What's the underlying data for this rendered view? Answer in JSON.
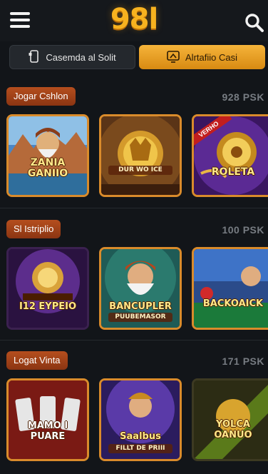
{
  "header": {
    "logo_text": "98l",
    "menu_icon": "hamburger-icon",
    "search_icon": "search-icon"
  },
  "tabs": [
    {
      "label": "Casemda al Solit",
      "icon": "phone-icon",
      "active": false
    },
    {
      "label": "Alrtafiio Casi",
      "icon": "casino-icon",
      "active": true
    }
  ],
  "sections": [
    {
      "title": "Jogar Cshlon",
      "count": "928 PSK",
      "games": [
        {
          "title": "ZANIA GANIIO",
          "subtitle": ""
        },
        {
          "title": "",
          "subtitle": "DUR WO ICE"
        },
        {
          "title": "ROLETA",
          "subtitle": "",
          "badge": "VERHO"
        }
      ]
    },
    {
      "title": "Sl Istriplio",
      "count": "100 PSK",
      "games": [
        {
          "title": "I12 EYPEIO",
          "subtitle": ""
        },
        {
          "title": "BANCUPLER",
          "subtitle": "PUUBEMASOR"
        },
        {
          "title": "BACKOAICK",
          "subtitle": ""
        }
      ]
    },
    {
      "title": "Logat Vinta",
      "count": "171 PSK",
      "games": [
        {
          "title": "MAMO I PUARE",
          "subtitle": ""
        },
        {
          "title": "Saalbus",
          "subtitle": "FILLT DE PRIII"
        },
        {
          "title": "YOLCA OANUO",
          "subtitle": ""
        }
      ]
    }
  ],
  "colors": {
    "accent": "#f5a623",
    "background": "#121519",
    "badge": "#a3431a"
  }
}
